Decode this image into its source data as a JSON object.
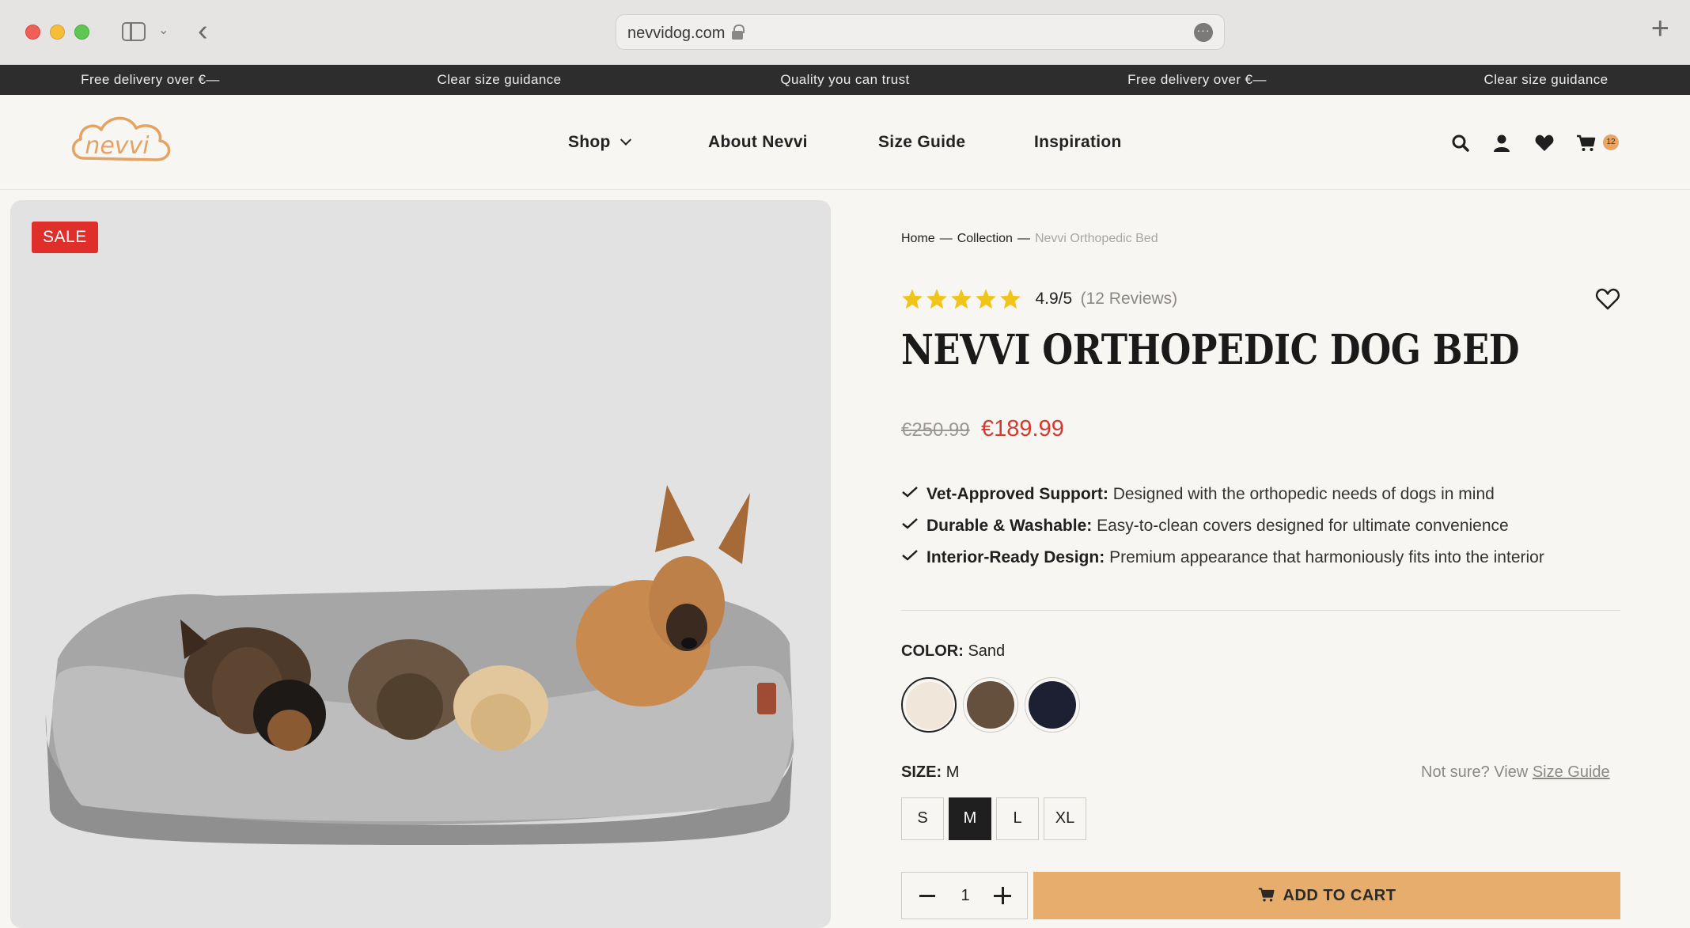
{
  "browser": {
    "url": "nevvidog.com"
  },
  "announcements": [
    "Free delivery over €—",
    "Clear size guidance",
    "Quality you can trust",
    "Free delivery over €—",
    "Clear size guidance"
  ],
  "header": {
    "logo_text": "nevvi",
    "nav": [
      "Shop",
      "About Nevvi",
      "Size Guide",
      "Inspiration"
    ],
    "icons": [
      "search-icon",
      "account-icon",
      "heart-icon",
      "cart-icon"
    ],
    "cart_count": "12"
  },
  "product": {
    "badge": "SALE",
    "breadcrumb": [
      "Home",
      "Collection",
      "Nevvi Orthopedic Bed"
    ],
    "breadcrumb_separator": "—",
    "rating_stars": 5,
    "rating_score": "4.9/5",
    "rating_count": "(12 Reviews)",
    "title": "NEVVI ORTHOPEDIC DOG BED",
    "price_old": "€250.99",
    "price_new": "€189.99",
    "features": [
      {
        "title": "Vet-Approved Support:",
        "text": "Designed with the orthopedic needs of dogs in mind"
      },
      {
        "title": "Durable & Washable:",
        "text": "Easy-to-clean covers designed for ultimate convenience"
      },
      {
        "title": "Interior-Ready Design:",
        "text": "Premium appearance that harmoniously fits into the interior"
      }
    ],
    "color_label": "COLOR:",
    "color_value": "Sand",
    "colors": [
      {
        "name": "Sand",
        "hex": "#f1e6da"
      },
      {
        "name": "Brown",
        "hex": "#65503e"
      },
      {
        "name": "Navy",
        "hex": "#1d1f33"
      }
    ],
    "size_label": "SIZE:",
    "size_value": "M",
    "size_help_prefix": "Not sure? View",
    "size_help_link": "Size Guide",
    "sizes": [
      "S",
      "M",
      "L",
      "XL"
    ],
    "selected_size": "M",
    "quantity": "1",
    "add_to_cart": "ADD TO CART"
  },
  "colors": {
    "sale_red": "#e02f2a",
    "price_red": "#d23b2f",
    "star_gold": "#f0c419",
    "cta": "#e6ad6c",
    "announcement_bg": "#2d2d2d"
  }
}
